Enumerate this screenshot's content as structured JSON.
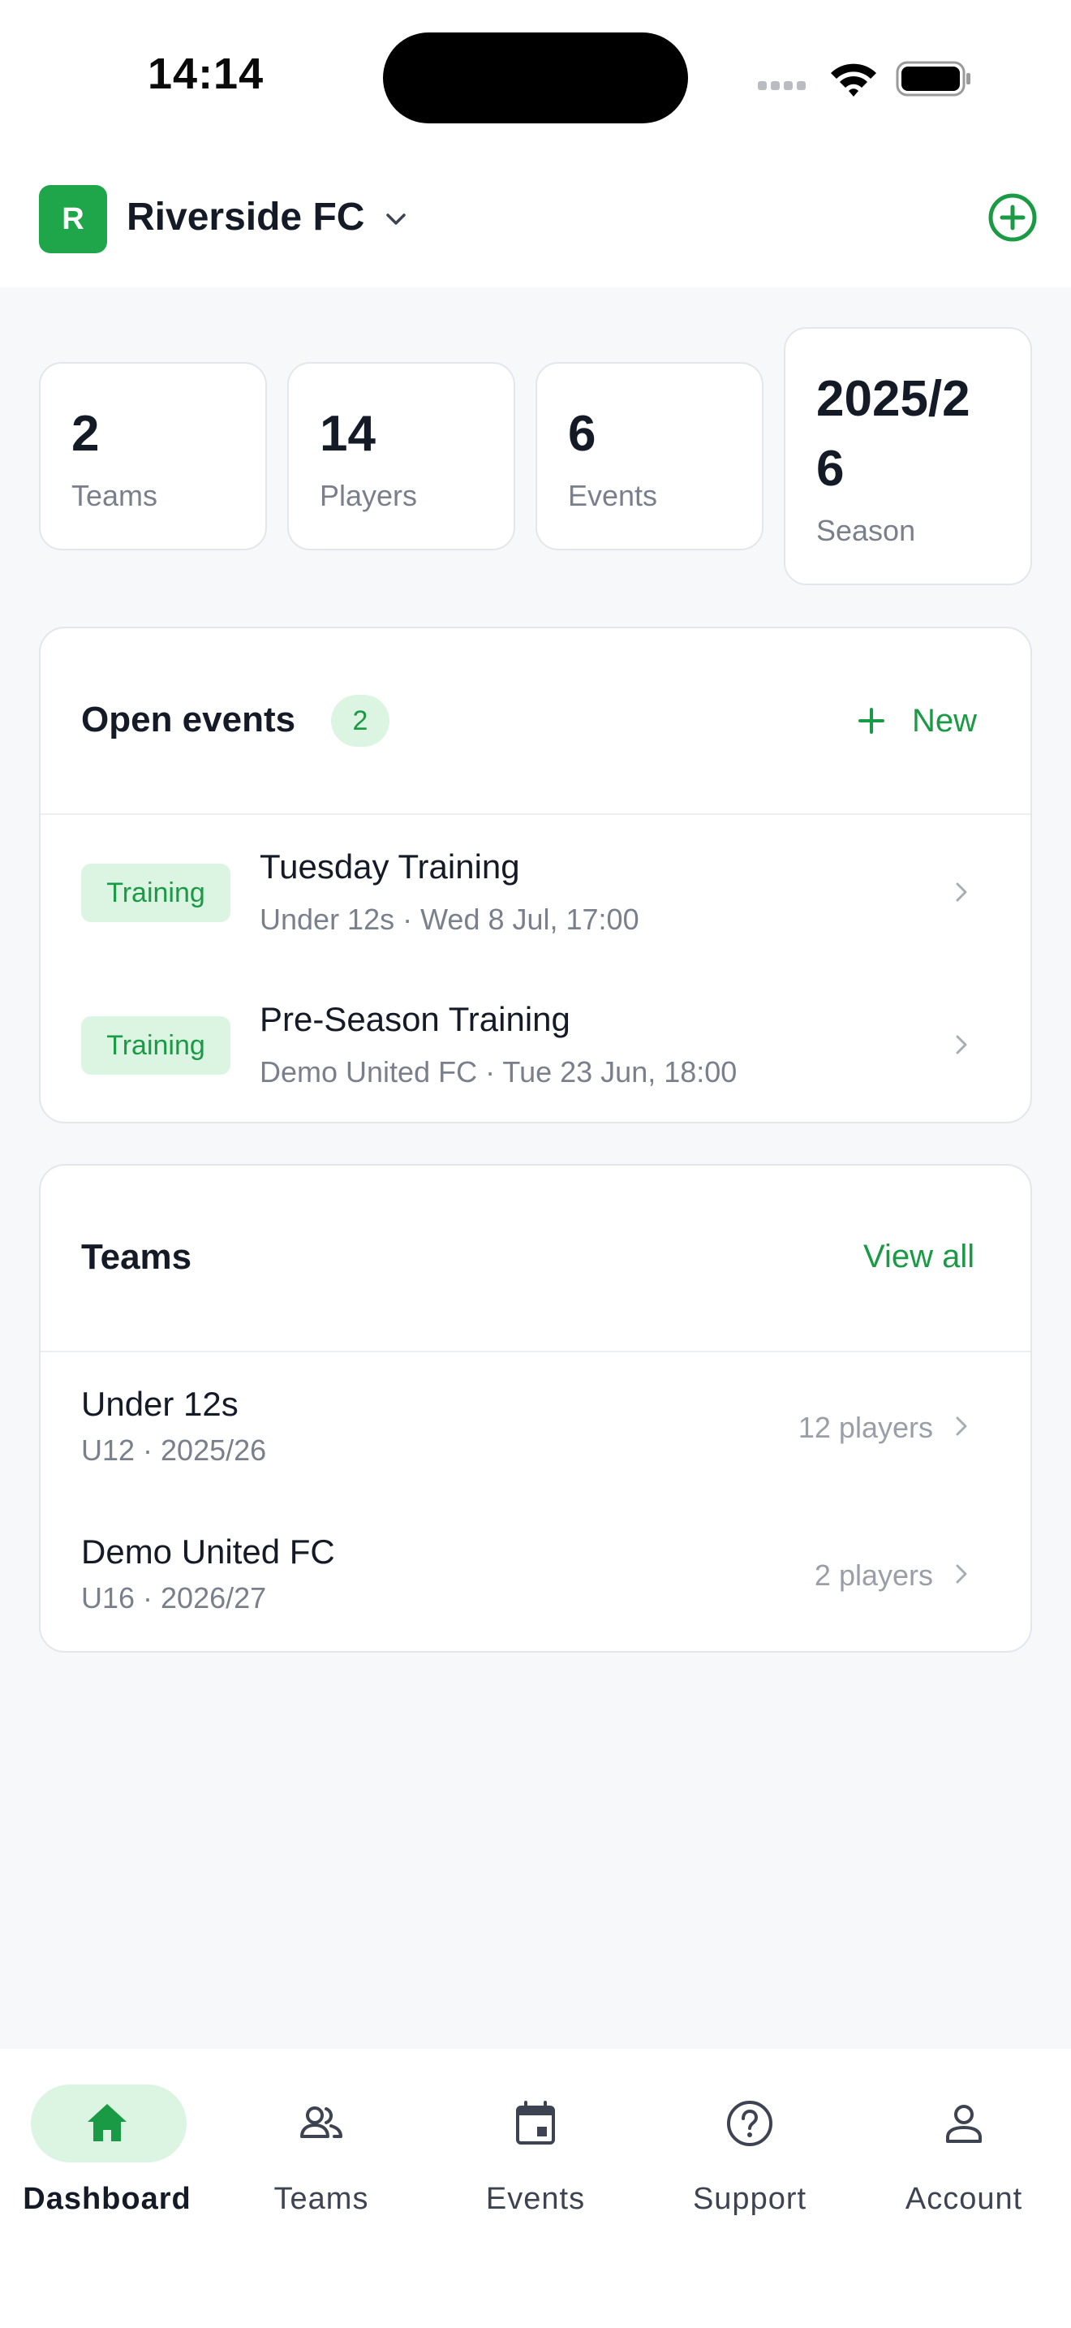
{
  "status_bar": {
    "time": "14:14"
  },
  "header": {
    "club_initial": "R",
    "club_name": "Riverside FC",
    "accent": "#1fa64a"
  },
  "stats": [
    {
      "value": "2",
      "label": "Teams"
    },
    {
      "value": "14",
      "label": "Players"
    },
    {
      "value": "6",
      "label": "Events"
    },
    {
      "value_line1": "2025/2",
      "value_line2": "6",
      "label": "Season"
    }
  ],
  "open_events": {
    "title": "Open events",
    "count": "2",
    "new_label": "New",
    "items": [
      {
        "tag": "Training",
        "title": "Tuesday Training",
        "subtitle": "Under 12s · Wed 8 Jul, 17:00"
      },
      {
        "tag": "Training",
        "title": "Pre-Season Training",
        "subtitle": "Demo United FC · Tue 23 Jun, 18:00"
      }
    ]
  },
  "teams": {
    "title": "Teams",
    "view_all_label": "View all",
    "items": [
      {
        "name": "Under 12s",
        "meta": "U12 · 2025/26",
        "players": "12 players"
      },
      {
        "name": "Demo United FC",
        "meta": "U16 · 2026/27",
        "players": "2 players"
      }
    ]
  },
  "nav": {
    "items": [
      {
        "label": "Dashboard",
        "icon": "home-icon",
        "active": true
      },
      {
        "label": "Teams",
        "icon": "people-icon",
        "active": false
      },
      {
        "label": "Events",
        "icon": "calendar-icon",
        "active": false
      },
      {
        "label": "Support",
        "icon": "help-icon",
        "active": false
      },
      {
        "label": "Account",
        "icon": "person-icon",
        "active": false
      }
    ]
  }
}
